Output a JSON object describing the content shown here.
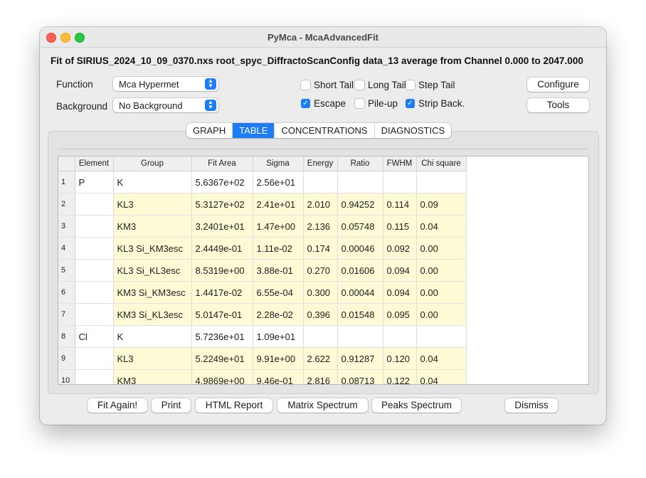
{
  "window": {
    "title": "PyMca - McaAdvancedFit"
  },
  "heading": "Fit of SIRIUS_2024_10_09_0370.nxs root_spyc_DiffractoScanConfig data_13 average from Channel 0.000 to 2047.000",
  "controls": {
    "function_label": "Function",
    "function_value": "Mca Hypermet",
    "background_label": "Background",
    "background_value": "No Background",
    "checkboxes": {
      "short_tail": {
        "label": "Short Tail",
        "checked": false
      },
      "long_tail": {
        "label": "Long Tail",
        "checked": false
      },
      "step_tail": {
        "label": "Step Tail",
        "checked": false
      },
      "escape": {
        "label": "Escape",
        "checked": true
      },
      "pileup": {
        "label": "Pile-up",
        "checked": false
      },
      "strip_back": {
        "label": "Strip Back.",
        "checked": true
      }
    },
    "configure_label": "Configure",
    "tools_label": "Tools"
  },
  "tabs": [
    "GRAPH",
    "TABLE",
    "CONCENTRATIONS",
    "DIAGNOSTICS"
  ],
  "active_tab": "TABLE",
  "table": {
    "headers": [
      "Element",
      "Group",
      "Fit Area",
      "Sigma",
      "Energy",
      "Ratio",
      "FWHM",
      "Chi square"
    ],
    "rows": [
      {
        "n": "1",
        "element": "P",
        "group": "K",
        "fit_area": "5.6367e+02",
        "sigma": "2.56e+01",
        "energy": "",
        "ratio": "",
        "fwhm": "",
        "chi": ""
      },
      {
        "n": "2",
        "element": "",
        "group": "KL3",
        "fit_area": "5.3127e+02",
        "sigma": "2.41e+01",
        "energy": "2.010",
        "ratio": "0.94252",
        "fwhm": "0.114",
        "chi": "0.09"
      },
      {
        "n": "3",
        "element": "",
        "group": "KM3",
        "fit_area": "3.2401e+01",
        "sigma": "1.47e+00",
        "energy": "2.136",
        "ratio": "0.05748",
        "fwhm": "0.115",
        "chi": "0.04"
      },
      {
        "n": "4",
        "element": "",
        "group": "KL3 Si_KM3esc",
        "fit_area": "2.4449e-01",
        "sigma": "1.11e-02",
        "energy": "0.174",
        "ratio": "0.00046",
        "fwhm": "0.092",
        "chi": "0.00"
      },
      {
        "n": "5",
        "element": "",
        "group": "KL3 Si_KL3esc",
        "fit_area": "8.5319e+00",
        "sigma": "3.88e-01",
        "energy": "0.270",
        "ratio": "0.01606",
        "fwhm": "0.094",
        "chi": "0.00"
      },
      {
        "n": "6",
        "element": "",
        "group": "KM3 Si_KM3esc",
        "fit_area": "1.4417e-02",
        "sigma": "6.55e-04",
        "energy": "0.300",
        "ratio": "0.00044",
        "fwhm": "0.094",
        "chi": "0.00"
      },
      {
        "n": "7",
        "element": "",
        "group": "KM3 Si_KL3esc",
        "fit_area": "5.0147e-01",
        "sigma": "2.28e-02",
        "energy": "0.396",
        "ratio": "0.01548",
        "fwhm": "0.095",
        "chi": "0.00"
      },
      {
        "n": "8",
        "element": "Cl",
        "group": "K",
        "fit_area": "5.7236e+01",
        "sigma": "1.09e+01",
        "energy": "",
        "ratio": "",
        "fwhm": "",
        "chi": ""
      },
      {
        "n": "9",
        "element": "",
        "group": "KL3",
        "fit_area": "5.2249e+01",
        "sigma": "9.91e+00",
        "energy": "2.622",
        "ratio": "0.91287",
        "fwhm": "0.120",
        "chi": "0.04"
      },
      {
        "n": "10",
        "element": "",
        "group": "KM3",
        "fit_area": "4.9869e+00",
        "sigma": "9.46e-01",
        "energy": "2.816",
        "ratio": "0.08713",
        "fwhm": "0.122",
        "chi": "0.04"
      }
    ]
  },
  "buttons": {
    "fit_again": "Fit Again!",
    "print": "Print",
    "html_report": "HTML Report",
    "matrix_spectrum": "Matrix Spectrum",
    "peaks_spectrum": "Peaks Spectrum",
    "dismiss": "Dismiss"
  },
  "colors": {
    "accent": "#1e7cf6",
    "subrow_highlight": "#fffad6"
  },
  "icons": {
    "select_arrows": "updown-chevron-icon",
    "checkmark": "check-icon"
  }
}
